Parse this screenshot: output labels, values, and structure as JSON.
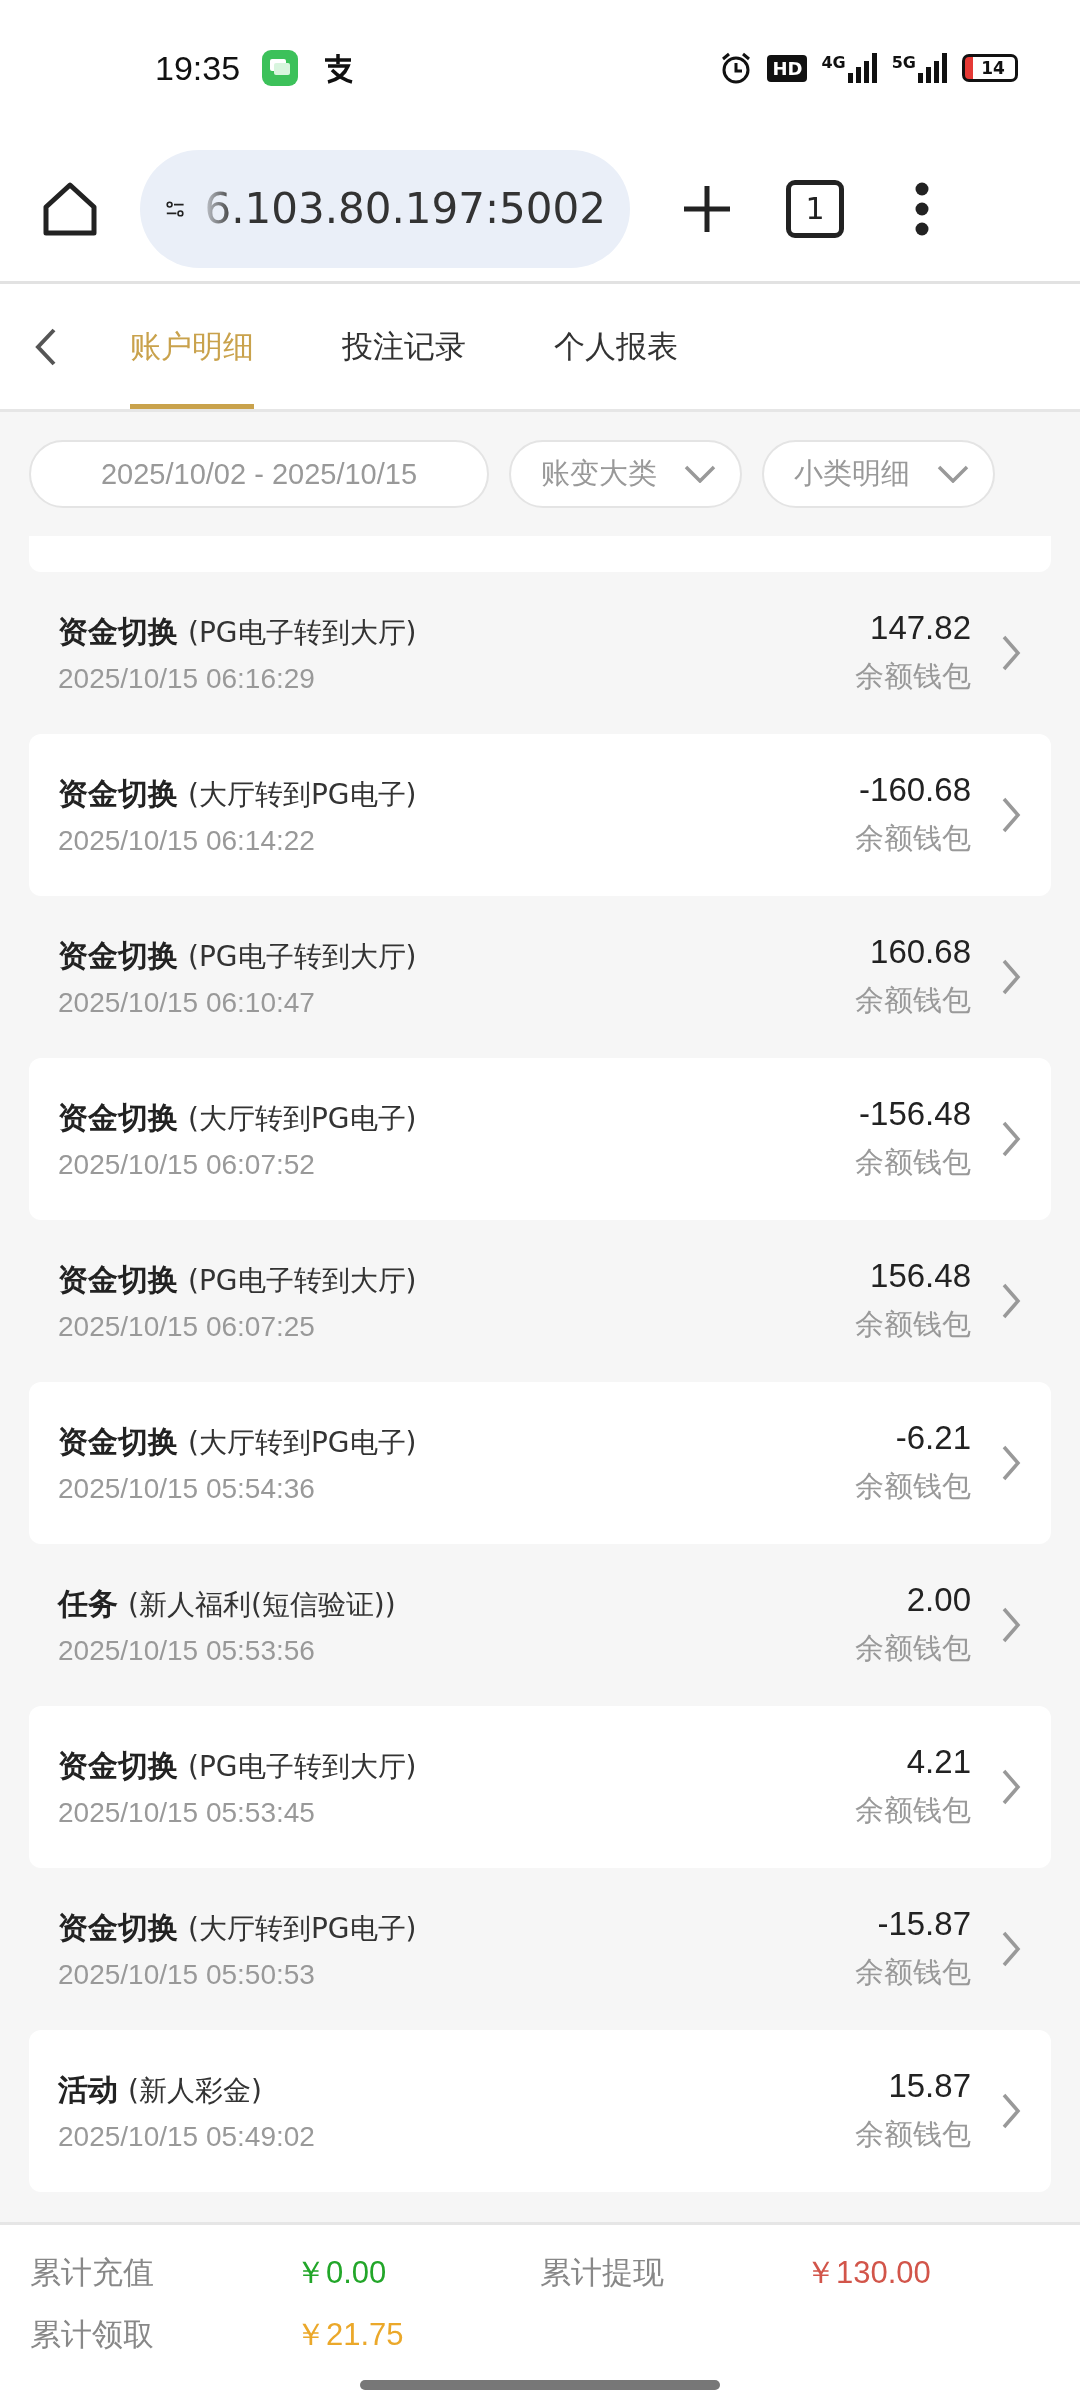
{
  "status_bar": {
    "time": "19:35",
    "hd": "HD",
    "networks": [
      "4G",
      "5G"
    ],
    "battery": "14"
  },
  "browser": {
    "url": "6.103.80.197:5002",
    "tab_count": "1"
  },
  "tabs": [
    {
      "label": "账户明细",
      "selected": true
    },
    {
      "label": "投注记录",
      "selected": false
    },
    {
      "label": "个人报表",
      "selected": false
    }
  ],
  "filters": {
    "date_range": "2025/10/02 - 2025/10/15",
    "dropdowns": [
      {
        "placeholder": "账变大类"
      },
      {
        "placeholder": "小类明细"
      }
    ]
  },
  "transactions": [
    {
      "title": "资金切换",
      "detail": "(PG电子转到大厅)",
      "time": "2025/10/15 06:16:29",
      "amount": "147.82",
      "wallet": "余额钱包"
    },
    {
      "title": "资金切换",
      "detail": "(大厅转到PG电子)",
      "time": "2025/10/15 06:14:22",
      "amount": "-160.68",
      "wallet": "余额钱包"
    },
    {
      "title": "资金切换",
      "detail": "(PG电子转到大厅)",
      "time": "2025/10/15 06:10:47",
      "amount": "160.68",
      "wallet": "余额钱包"
    },
    {
      "title": "资金切换",
      "detail": "(大厅转到PG电子)",
      "time": "2025/10/15 06:07:52",
      "amount": "-156.48",
      "wallet": "余额钱包"
    },
    {
      "title": "资金切换",
      "detail": "(PG电子转到大厅)",
      "time": "2025/10/15 06:07:25",
      "amount": "156.48",
      "wallet": "余额钱包"
    },
    {
      "title": "资金切换",
      "detail": "(大厅转到PG电子)",
      "time": "2025/10/15 05:54:36",
      "amount": "-6.21",
      "wallet": "余额钱包"
    },
    {
      "title": "任务",
      "detail": "(新人福利(短信验证))",
      "time": "2025/10/15 05:53:56",
      "amount": "2.00",
      "wallet": "余额钱包"
    },
    {
      "title": "资金切换",
      "detail": "(PG电子转到大厅)",
      "time": "2025/10/15 05:53:45",
      "amount": "4.21",
      "wallet": "余额钱包"
    },
    {
      "title": "资金切换",
      "detail": "(大厅转到PG电子)",
      "time": "2025/10/15 05:50:53",
      "amount": "-15.87",
      "wallet": "余额钱包"
    },
    {
      "title": "活动",
      "detail": "(新人彩金)",
      "time": "2025/10/15 05:49:02",
      "amount": "15.87",
      "wallet": "余额钱包"
    }
  ],
  "summary": [
    {
      "label": "累计充值",
      "value": "￥0.00",
      "color": "#22a629"
    },
    {
      "label": "累计提现",
      "value": "￥130.00",
      "color": "#d2554a"
    },
    {
      "label": "累计领取",
      "value": "￥21.75",
      "color": "#eba82a"
    }
  ]
}
